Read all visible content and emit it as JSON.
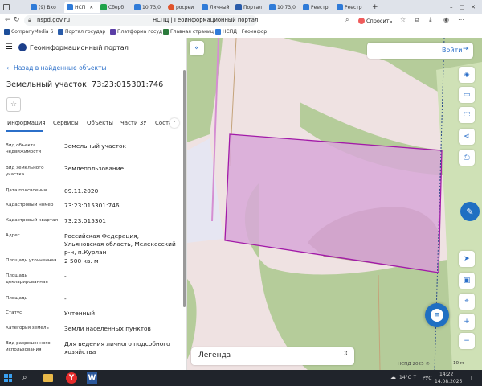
{
  "browser": {
    "tabs": [
      {
        "label": "(9) Вхо",
        "color": "#2f7bd8"
      },
      {
        "label": "НСП",
        "color": "#2f7bd8"
      },
      {
        "label": "Сберб",
        "color": "#1fa34a"
      },
      {
        "label": "10,73,0",
        "color": "#2f7bd8"
      },
      {
        "label": "росреи",
        "color": "#e0532b"
      },
      {
        "label": "Личный",
        "color": "#2f7bd8"
      },
      {
        "label": "Портал",
        "color": "#2a5caa"
      },
      {
        "label": "10,73,0",
        "color": "#2f7bd8"
      },
      {
        "label": "Реестр",
        "color": "#2f7bd8"
      },
      {
        "label": "Реестр",
        "color": "#2f7bd8"
      }
    ],
    "new_tab": "+",
    "url": "nspd.gov.ru",
    "page_title": "НСПД | Геоинформационный портал",
    "ask_label": "Спросить",
    "bookmarks": [
      "CompanyMedia 6",
      "Портал государ",
      "Платформа госуд",
      "Главная страниц",
      "НСПД | Геоинфор"
    ]
  },
  "portal": {
    "brand": "Геоинформационный портал",
    "back_link": "Назад в найденные объекты",
    "object_title": "Земельный участок: 73:23:015301:746",
    "tabs": [
      "Информация",
      "Сервисы",
      "Объекты",
      "Части ЗУ",
      "Состав"
    ],
    "active_tab": 0,
    "fields": [
      {
        "label": "Вид объекта недвижимости",
        "value": "Земельный участок"
      },
      {
        "label": "Вид земельного участка",
        "value": "Землепользование"
      },
      {
        "label": "Дата присвоения",
        "value": "09.11.2020"
      },
      {
        "label": "Кадастровый номер",
        "value": "73:23:015301:746"
      },
      {
        "label": "Кадастровый квартал",
        "value": "73:23:015301"
      },
      {
        "label": "Адрес",
        "value": "Российская Федерация, Ульяновская область, Мелекесский р-н, п.Курлан"
      },
      {
        "label": "Площадь уточненная",
        "value": "2 500 кв. м"
      },
      {
        "label": "Площадь декларированная",
        "value": "-"
      },
      {
        "label": "Площадь",
        "value": "-"
      },
      {
        "label": "Статус",
        "value": "Учтенный"
      },
      {
        "label": "Категория земель",
        "value": "Земли населенных пунктов"
      },
      {
        "label": "Вид разрешенного использования",
        "value": "Для ведения личного подсобного хозяйства"
      }
    ]
  },
  "map": {
    "login_label": "Войти",
    "legend_label": "Легенда",
    "attribution": "НСПД 2025 ©",
    "scale_label": "10 м",
    "colors": {
      "parcel_fill": "#d8a8d8",
      "parcel_stroke": "#a21aa8",
      "green": "#b5cc9a",
      "brown": "#ad9585",
      "pink": "#efe2e2"
    }
  },
  "taskbar": {
    "temperature": "14°C",
    "lang": "РУС",
    "time": "14:22",
    "date": "14.08.2025"
  }
}
